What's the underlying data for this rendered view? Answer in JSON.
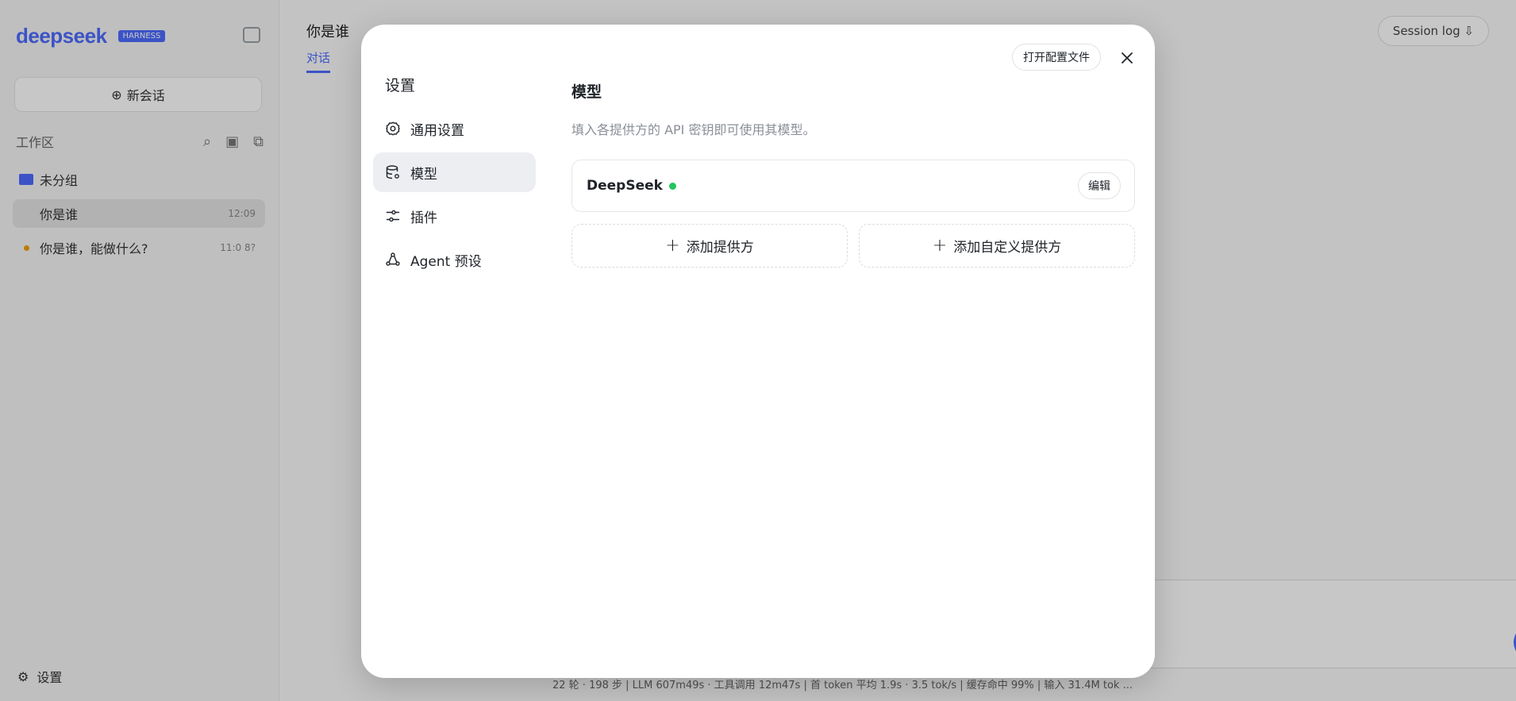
{
  "background": {
    "brand": {
      "logo_text": "deepseek",
      "badge": "HARNESS"
    },
    "new_chat_label": "新会话",
    "workspace_label": "工作区",
    "folder_label": "未分组",
    "sessions": [
      {
        "title": "你是谁",
        "time": "12:09"
      },
      {
        "title": "你是谁，能做什么?",
        "time": "11:0 8?"
      }
    ],
    "settings_label": "设置",
    "header_title": "你是谁",
    "header_sub_tab": "对话",
    "session_log_label": "Session log ⇩",
    "stats_text": "22 轮 · 198 步  |  LLM 607m49s · 工具调用 12m47s  |  首 token 平均 1.9s · 3.5 tok/s  |  缓存命中 99%  |  输入 31.4M tok ..."
  },
  "modal": {
    "title": "设置",
    "open_config_label": "打开配置文件",
    "nav": [
      {
        "key": "general",
        "label": "通用设置",
        "icon": "gear-icon"
      },
      {
        "key": "models",
        "label": "模型",
        "icon": "database-gear-icon",
        "active": true
      },
      {
        "key": "plugins",
        "label": "插件",
        "icon": "sliders-icon"
      },
      {
        "key": "agent",
        "label": "Agent 预设",
        "icon": "agent-network-icon"
      }
    ],
    "models": {
      "title": "模型",
      "description": "填入各提供方的 API 密钥即可使用其模型。",
      "providers": [
        {
          "name": "DeepSeek",
          "status_color": "#22c55e",
          "edit_label": "编辑"
        }
      ],
      "add_provider_label": "添加提供方",
      "add_custom_provider_label": "添加自定义提供方"
    }
  },
  "colors": {
    "accent": "#4d6bfe",
    "status_ok": "#22c55e"
  }
}
